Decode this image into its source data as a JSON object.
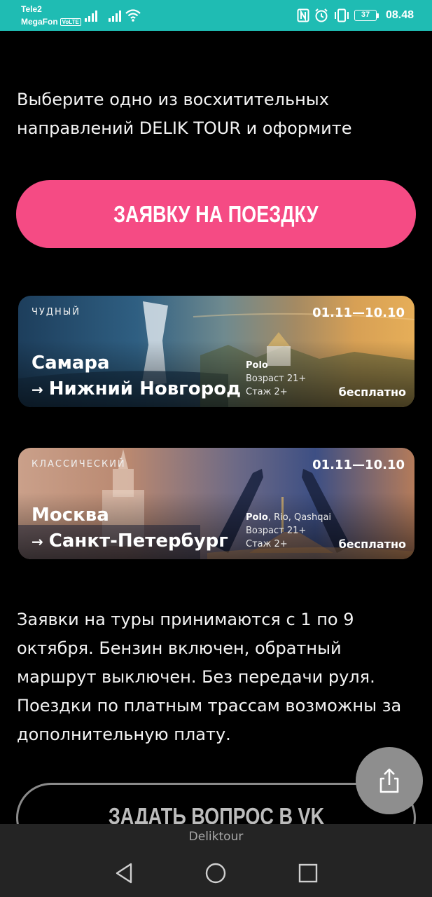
{
  "status_bar": {
    "carrier_1": "Tele2",
    "carrier_2": "MegaFon",
    "volte": "VoLTE",
    "battery": "37",
    "time": "08.48",
    "color": "#1fbcb3"
  },
  "intro_text": "Выберите одно из восхитительных направлений DELIK TOUR и оформите",
  "cta_label": "ЗАЯВКУ НА ПОЕЗДКУ",
  "tours": [
    {
      "type": "ЧУДНЫЙ",
      "dates": "01.11—10.10",
      "from": "Самара",
      "arrow": "→",
      "to": "Нижний Новгород",
      "car": "Polo",
      "car_extra": "",
      "age": "Возраст 21+",
      "experience": "Стаж 2+",
      "price": "бесплатно"
    },
    {
      "type": "КЛАССИЧЕСКИЙ",
      "dates": "01.11—10.10",
      "from": "Москва",
      "arrow": "→",
      "to": "Санкт-Петербург",
      "car": "Polo",
      "car_extra": ", Rio, Qashqai",
      "age": "Возраст 21+",
      "experience": "Стаж 2+",
      "price": "бесплатно"
    }
  ],
  "info_text": "Заявки на туры принимаются с 1 по 9 октября. Бензин включен, обратный маршрут выключен. Без передачи руля. Поездки по платным трассам возможны за дополнительную плату.",
  "ask_label": "ЗАДАТЬ ВОПРОС В VK",
  "bottom_bar": {
    "site_name": "Deliktour"
  },
  "icons": [
    "nfc-icon",
    "alarm-icon",
    "vibrate-icon",
    "share-icon",
    "back-icon",
    "home-icon",
    "recents-icon"
  ],
  "colors": {
    "accent": "#f54b84",
    "background": "#000000",
    "outline": "#8a8a8a"
  }
}
